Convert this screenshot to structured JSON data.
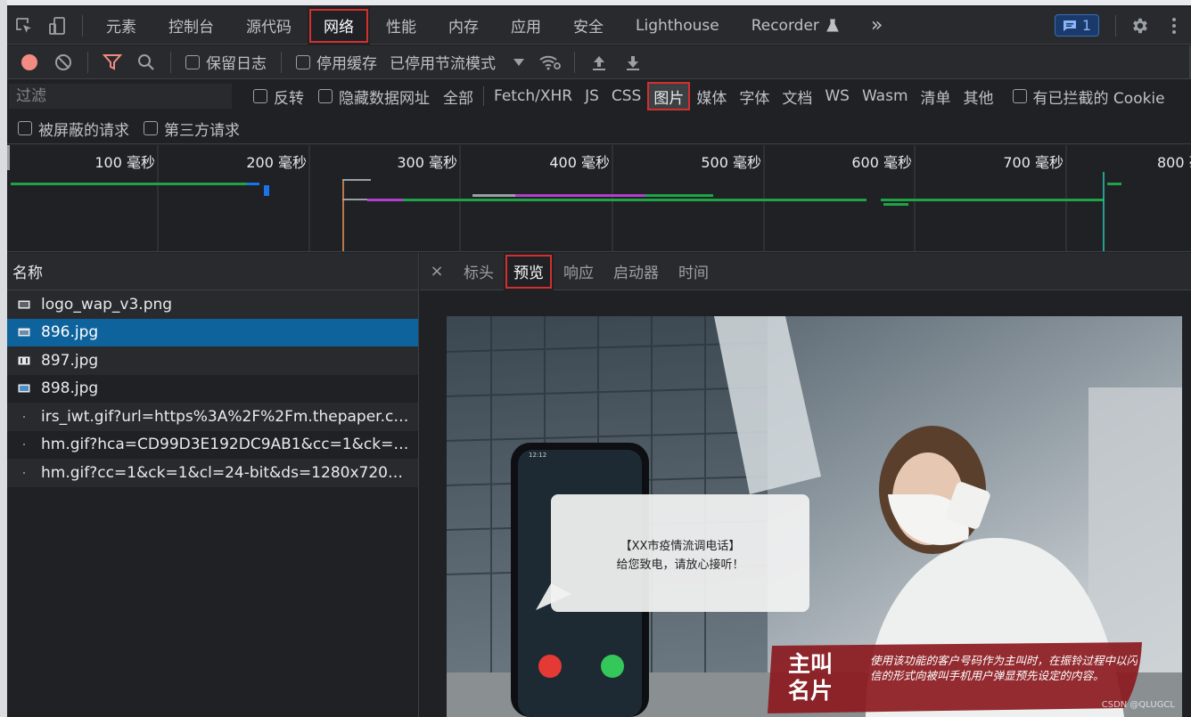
{
  "tabbar": {
    "tabs": [
      "元素",
      "控制台",
      "源代码",
      "网络",
      "性能",
      "内存",
      "应用",
      "安全",
      "Lighthouse",
      "Recorder"
    ],
    "active_index": 3,
    "more": "»",
    "issues_count": "1"
  },
  "toolbar": {
    "preserve_log": "保留日志",
    "disable_cache": "停用缓存",
    "throttling": "已停用节流模式"
  },
  "filter": {
    "placeholder": "过滤",
    "invert": "反转",
    "hide_data_urls": "隐藏数据网址",
    "types": [
      "全部",
      "Fetch/XHR",
      "JS",
      "CSS",
      "图片",
      "媒体",
      "字体",
      "文档",
      "WS",
      "Wasm",
      "清单",
      "其他"
    ],
    "active_type_index": 4,
    "blocked_cookies": "有已拦截的 Cookie",
    "blocked_requests": "被屏蔽的请求",
    "third_party": "第三方请求"
  },
  "overview": {
    "ticks": [
      "100 毫秒",
      "200 毫秒",
      "300 毫秒",
      "400 毫秒",
      "500 毫秒",
      "600 毫秒",
      "700 毫秒",
      "800 毫"
    ]
  },
  "requests": {
    "column_header": "名称",
    "items": [
      {
        "name": "logo_wap_v3.png",
        "icon": "image-icon"
      },
      {
        "name": "896.jpg",
        "icon": "image-icon"
      },
      {
        "name": "897.jpg",
        "icon": "image-icon"
      },
      {
        "name": "898.jpg",
        "icon": "image-icon"
      },
      {
        "name": "irs_iwt.gif?url=https%3A%2F%2Fm.thepaper.cn%2...",
        "icon": "dot-icon"
      },
      {
        "name": "hm.gif?hca=CD99D3E192DC9AB1&cc=1&ck=1&cl...",
        "icon": "dot-icon"
      },
      {
        "name": "hm.gif?cc=1&ck=1&cl=24-bit&ds=1280x720&vl=...",
        "icon": "dot-icon"
      }
    ],
    "selected_index": 1
  },
  "detail": {
    "tabs": [
      "标头",
      "预览",
      "响应",
      "启动器",
      "时间"
    ],
    "active_index": 1,
    "close": "×"
  },
  "preview_image": {
    "phone_time": "12:12",
    "notification_title": "【XX市疫情流调电话】",
    "notification_body": "给您致电，请放心接听！",
    "banner_title_1": "主叫",
    "banner_title_2": "名片",
    "banner_text": "使用该功能的客户号码作为主叫时，在振铃过程中以闪信的形式向被叫手机用户弹显预先设定的内容。",
    "watermark": "CSDN @QLUGCL"
  },
  "colors": {
    "accent_blue": "#0e639c",
    "highlight_red": "#d32f2f",
    "record_red": "#f28b82"
  }
}
